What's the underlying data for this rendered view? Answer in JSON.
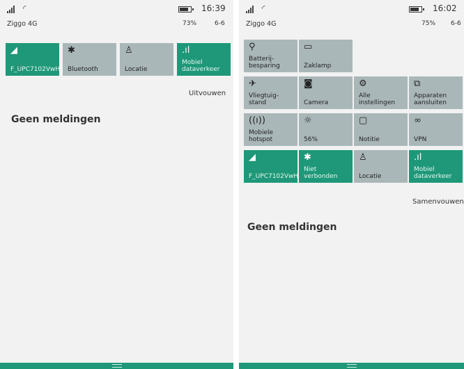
{
  "left": {
    "status": {
      "signal_icon": "signal-icon",
      "wifi_icon": "wifi-icon",
      "carrier": "Ziggo 4G",
      "time": "16:39",
      "battery_pct": "73%",
      "date": "6-6"
    },
    "tiles": [
      {
        "icon": "◢",
        "icon_name": "wifi-icon",
        "label": "F_UPC7102VwH",
        "active": true
      },
      {
        "icon": "✱",
        "icon_name": "bluetooth-icon",
        "label": "Bluetooth",
        "active": false
      },
      {
        "icon": "♙",
        "icon_name": "location-icon",
        "label": "Locatie",
        "active": false
      },
      {
        "icon": ".ıl",
        "icon_name": "cellular-data-icon",
        "label": "Mobiel\ndataverkeer",
        "active": true
      }
    ],
    "expand_label": "Uitvouwen",
    "no_notifications": "Geen meldingen"
  },
  "right": {
    "status": {
      "signal_icon": "signal-icon",
      "wifi_icon": "wifi-icon",
      "carrier": "Ziggo 4G",
      "time": "16:02",
      "battery_pct": "75%",
      "date": "6-6"
    },
    "tiles": [
      {
        "icon": "⚲",
        "icon_name": "battery-saver-icon",
        "label": "Batterij-\nbesparing",
        "active": false
      },
      {
        "icon": "▭",
        "icon_name": "flashlight-icon",
        "label": "Zaklamp",
        "active": false
      },
      {
        "icon": "✈",
        "icon_name": "airplane-icon",
        "label": "Vliegtuig-\nstand",
        "active": false
      },
      {
        "icon": "◙",
        "icon_name": "camera-icon",
        "label": "Camera",
        "active": false
      },
      {
        "icon": "⚙",
        "icon_name": "settings-icon",
        "label": "Alle\ninstellingen",
        "active": false
      },
      {
        "icon": "⧉",
        "icon_name": "connect-devices-icon",
        "label": "Apparaten\naansluiten",
        "active": false
      },
      {
        "icon": "((ı))",
        "icon_name": "hotspot-icon",
        "label": "Mobiele\nhotspot",
        "active": false
      },
      {
        "icon": "☼",
        "icon_name": "brightness-icon",
        "label": "56%",
        "active": false
      },
      {
        "icon": "▢",
        "icon_name": "notification-icon",
        "label": "Notitie",
        "active": false
      },
      {
        "icon": "∞",
        "icon_name": "vpn-icon",
        "label": "VPN",
        "active": false
      },
      {
        "icon": "◢",
        "icon_name": "wifi-icon",
        "label": "F_UPC7102VwH",
        "active": true
      },
      {
        "icon": "✱",
        "icon_name": "bluetooth-icon",
        "label": "Niet\nverbonden",
        "active": true
      },
      {
        "icon": "♙",
        "icon_name": "location-icon",
        "label": "Locatie",
        "active": false
      },
      {
        "icon": ".ıl",
        "icon_name": "cellular-data-icon",
        "label": "Mobiel\ndataverkeer",
        "active": true
      }
    ],
    "collapse_label": "Samenvouwen",
    "no_notifications": "Geen meldingen"
  },
  "colors": {
    "accent": "#1e9878",
    "tile_off": "#aab7b9",
    "background": "#f2f2f2"
  }
}
